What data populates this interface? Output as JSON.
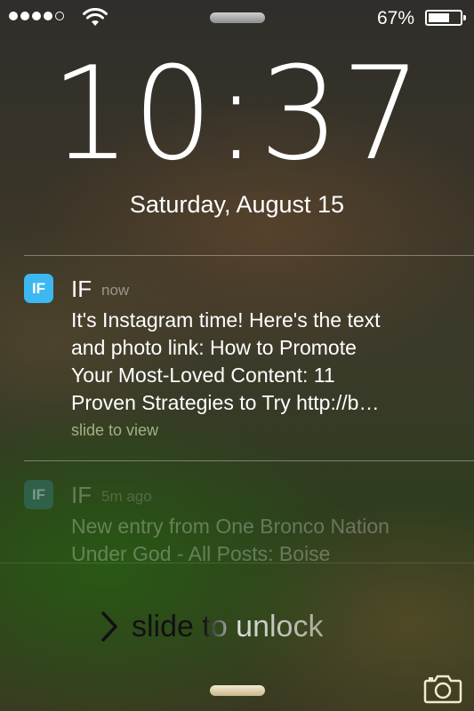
{
  "status_bar": {
    "signal_dots_filled": 4,
    "signal_dots_total": 5,
    "wifi_icon": "wifi-icon",
    "battery_percent_label": "67%",
    "battery_level": 0.67
  },
  "lock_screen": {
    "time": "10:37",
    "date": "Saturday, August 15",
    "slide_label": "slide to unlock",
    "camera_icon": "camera-icon"
  },
  "notifications": [
    {
      "app_icon_text": "IF",
      "app_name": "IF",
      "time": "now",
      "body_lines": [
        "It's Instagram time! Here's the text",
        "and photo link: How to Promote",
        "Your Most-Loved Content: 11",
        "Proven Strategies to Try http://b…"
      ],
      "action": "slide to view",
      "icon_color": "#3db8f0"
    },
    {
      "app_icon_text": "IF",
      "app_name": "IF",
      "time": "5m ago",
      "body_lines": [
        "New entry from One Bronco Nation",
        "Under God -  All Posts: Boise"
      ]
    }
  ]
}
